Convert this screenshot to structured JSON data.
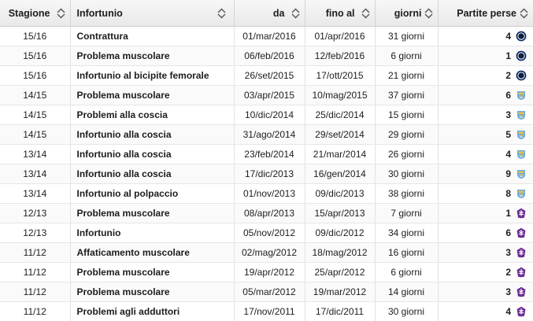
{
  "headers": {
    "season": "Stagione",
    "injury": "Infortunio",
    "from": "da",
    "until": "fino al",
    "days": "giorni",
    "games_missed": "Partite perse"
  },
  "club_icons": {
    "inter": {
      "name": "inter-crest-icon",
      "colors": [
        "#0a2f6b",
        "#111111",
        "#ffffff"
      ]
    },
    "city": {
      "name": "man-city-crest-icon",
      "colors": [
        "#6cabdd",
        "#e8c14a"
      ]
    },
    "fiorentina": {
      "name": "fiorentina-crest-icon",
      "colors": [
        "#6a2c91",
        "#ffffff"
      ]
    }
  },
  "rows": [
    {
      "season": "15/16",
      "injury": "Contrattura",
      "from": "01/mar/2016",
      "until": "01/apr/2016",
      "days": "31 giorni",
      "games": "4",
      "club": "inter"
    },
    {
      "season": "15/16",
      "injury": "Problema muscolare",
      "from": "06/feb/2016",
      "until": "12/feb/2016",
      "days": "6 giorni",
      "games": "1",
      "club": "inter"
    },
    {
      "season": "15/16",
      "injury": "Infortunio al bicipite femorale",
      "from": "26/set/2015",
      "until": "17/ott/2015",
      "days": "21 giorni",
      "games": "2",
      "club": "inter"
    },
    {
      "season": "14/15",
      "injury": "Problema muscolare",
      "from": "03/apr/2015",
      "until": "10/mag/2015",
      "days": "37 giorni",
      "games": "6",
      "club": "city"
    },
    {
      "season": "14/15",
      "injury": "Problemi alla coscia",
      "from": "10/dic/2014",
      "until": "25/dic/2014",
      "days": "15 giorni",
      "games": "3",
      "club": "city"
    },
    {
      "season": "14/15",
      "injury": "Infortunio alla coscia",
      "from": "31/ago/2014",
      "until": "29/set/2014",
      "days": "29 giorni",
      "games": "5",
      "club": "city"
    },
    {
      "season": "13/14",
      "injury": "Infortunio alla coscia",
      "from": "23/feb/2014",
      "until": "21/mar/2014",
      "days": "26 giorni",
      "games": "4",
      "club": "city"
    },
    {
      "season": "13/14",
      "injury": "Infortunio alla coscia",
      "from": "17/dic/2013",
      "until": "16/gen/2014",
      "days": "30 giorni",
      "games": "9",
      "club": "city"
    },
    {
      "season": "13/14",
      "injury": "Infortunio al polpaccio",
      "from": "01/nov/2013",
      "until": "09/dic/2013",
      "days": "38 giorni",
      "games": "8",
      "club": "city"
    },
    {
      "season": "12/13",
      "injury": "Problema muscolare",
      "from": "08/apr/2013",
      "until": "15/apr/2013",
      "days": "7 giorni",
      "games": "1",
      "club": "fiorentina"
    },
    {
      "season": "12/13",
      "injury": "Infortunio",
      "from": "05/nov/2012",
      "until": "09/dic/2012",
      "days": "34 giorni",
      "games": "6",
      "club": "fiorentina"
    },
    {
      "season": "11/12",
      "injury": "Affaticamento muscolare",
      "from": "02/mag/2012",
      "until": "18/mag/2012",
      "days": "16 giorni",
      "games": "3",
      "club": "fiorentina"
    },
    {
      "season": "11/12",
      "injury": "Problema muscolare",
      "from": "19/apr/2012",
      "until": "25/apr/2012",
      "days": "6 giorni",
      "games": "2",
      "club": "fiorentina"
    },
    {
      "season": "11/12",
      "injury": "Problema muscolare",
      "from": "05/mar/2012",
      "until": "19/mar/2012",
      "days": "14 giorni",
      "games": "3",
      "club": "fiorentina"
    },
    {
      "season": "11/12",
      "injury": "Problemi agli adduttori",
      "from": "17/nov/2011",
      "until": "17/dic/2011",
      "days": "30 giorni",
      "games": "4",
      "club": "fiorentina"
    }
  ]
}
